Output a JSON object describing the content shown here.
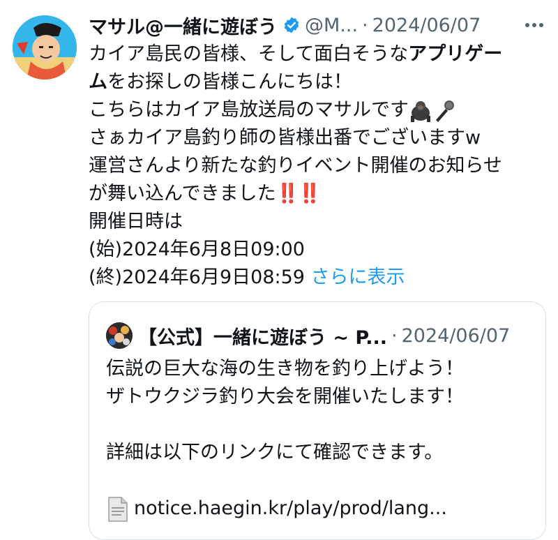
{
  "tweet": {
    "author_name": "マサル@一緒に遊ぼう",
    "handle": "@M...",
    "separator": "·",
    "date": "2024/06/07",
    "icons": {
      "verified": "verified-badge-icon",
      "more": "more-options-icon"
    },
    "lines": {
      "l1": "カイア島民の皆様、そして面白そうな",
      "l1_bold": "アプリゲー",
      "l2_bold": "ム",
      "l2": "をお探しの皆様こんにちは！",
      "l3": "こちらはカイア島放送局のマサルです",
      "l4": "さぁカイア島釣り師の皆様出番でございますw",
      "l5": "運営さんより新たな釣りイベント開催のお知らせ",
      "l6": "が舞い込んできました",
      "l6_bangs": "‼️‼️",
      "l7": "開催日時は",
      "l8": "(始)2024年6月8日09:00",
      "l9": "(終)2024年6月9日08:59",
      "show_more": "さらに表示"
    }
  },
  "quote": {
    "author_name": "【公式】一緒に遊ぼう ~ P...",
    "separator": "·",
    "date": "2024/06/07",
    "lines": {
      "q1": "伝説の巨大な海の生き物を釣り上げよう！",
      "q2": " ザトウクジラ釣り大会を開催いたします！",
      "q3": "詳細は以下のリンクにて確認できます。",
      "q4": "notice.haegin.kr/play/prod/lang..."
    },
    "icons": {
      "doc": "document-icon"
    }
  },
  "colors": {
    "link": "#1d9bf0",
    "secondary": "#536471",
    "verified": "#1d9bf0",
    "border": "#d6dde3"
  }
}
